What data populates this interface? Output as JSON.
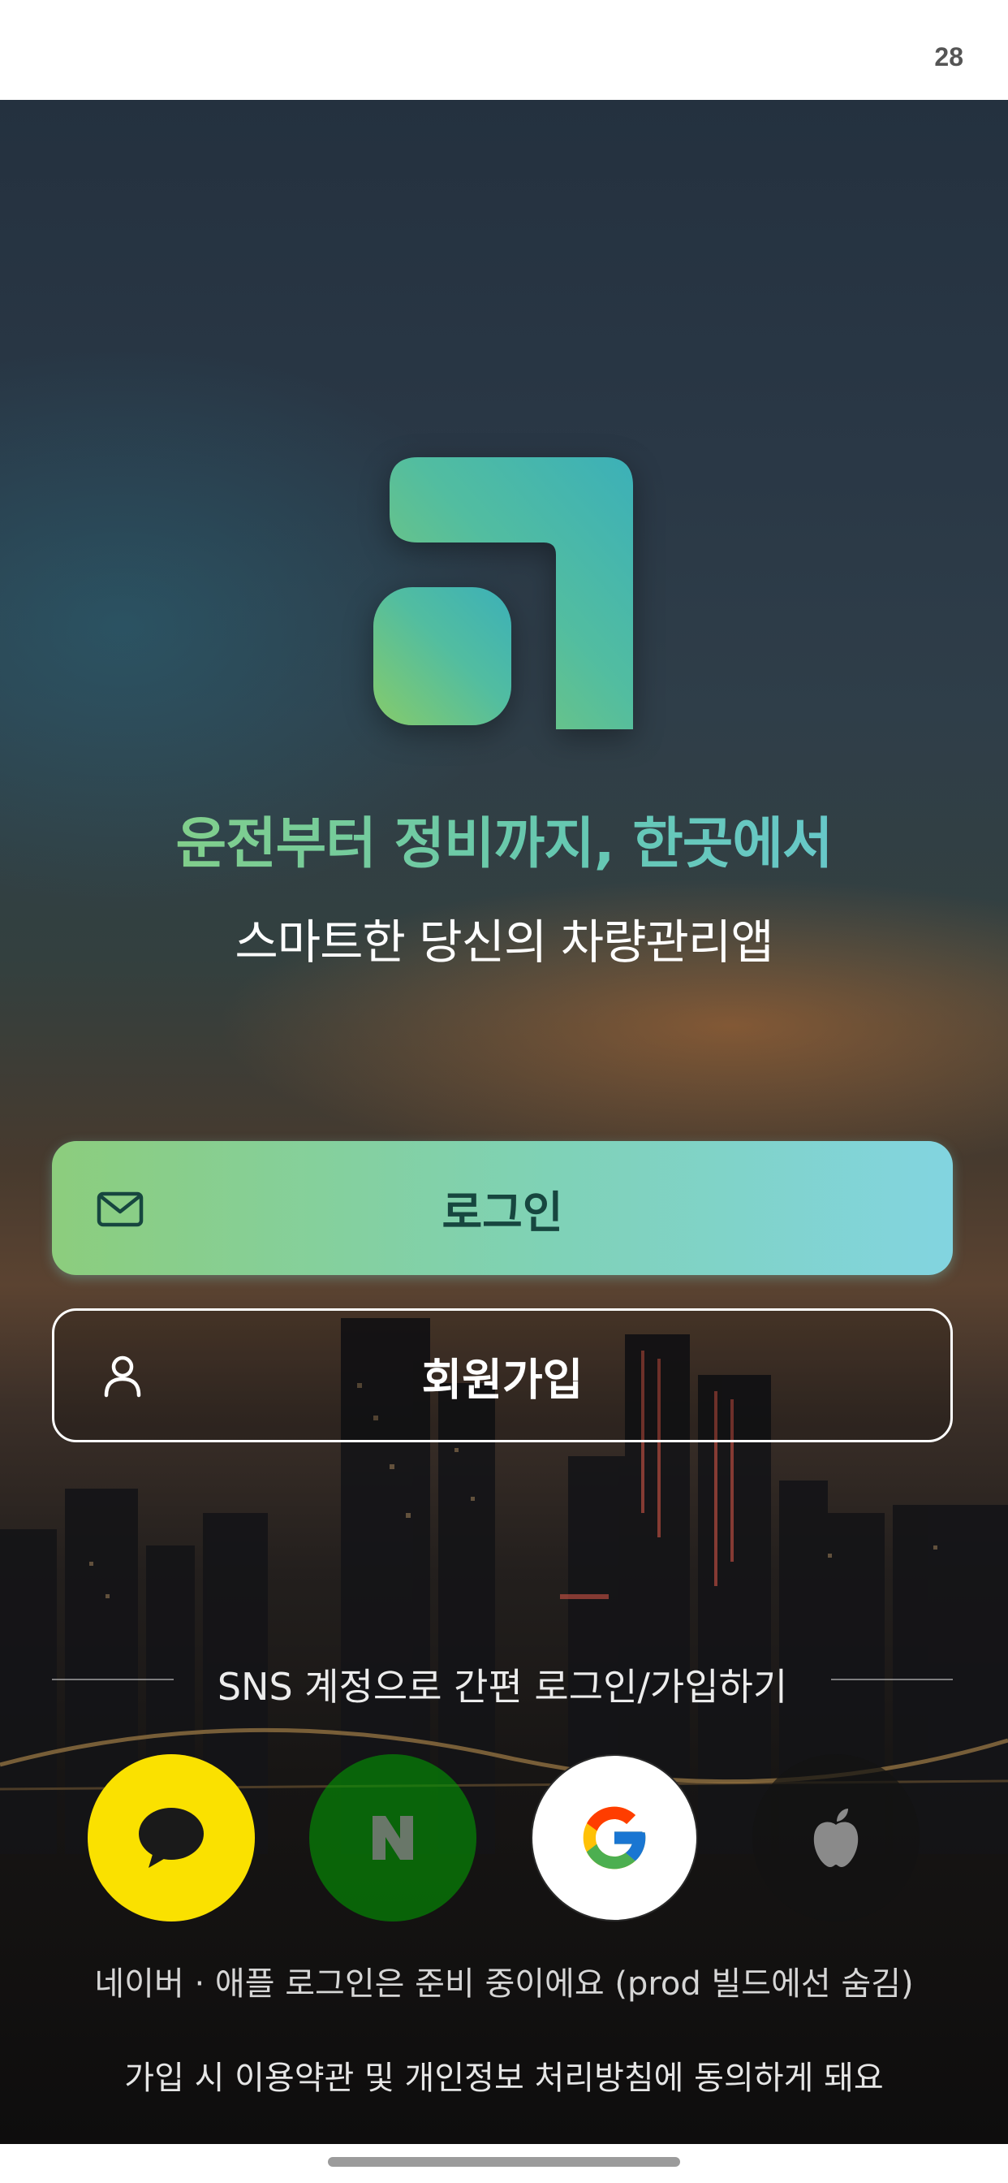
{
  "status_bar": {
    "time": "28"
  },
  "brand": {
    "logo_icon": "app-logo-icon",
    "headline": "운전부터 정비까지, 한곳에서",
    "subline": "스마트한 당신의 차량관리앱",
    "colors": {
      "green": "#8ed17a",
      "teal": "#68c8d8"
    }
  },
  "buttons": {
    "login": {
      "label": "로그인",
      "icon": "mail-icon"
    },
    "signup": {
      "label": "회원가입",
      "icon": "person-icon"
    }
  },
  "sns": {
    "divider_text": "SNS 계정으로 간편 로그인/가입하기",
    "providers": [
      {
        "name": "kakao",
        "icon": "kakao-talk-icon",
        "color": "#fae100"
      },
      {
        "name": "naver",
        "icon": "naver-icon",
        "color": "#03c75a"
      },
      {
        "name": "google",
        "icon": "google-icon",
        "color": "#ffffff"
      },
      {
        "name": "apple",
        "icon": "apple-icon",
        "color": "#121212"
      }
    ]
  },
  "notes": {
    "preparing": "네이버 · 애플 로그인은 준비 중이에요 (prod 빌드에선 숨김)",
    "terms": "가입 시 이용약관 및 개인정보 처리방침에 동의하게 돼요"
  }
}
